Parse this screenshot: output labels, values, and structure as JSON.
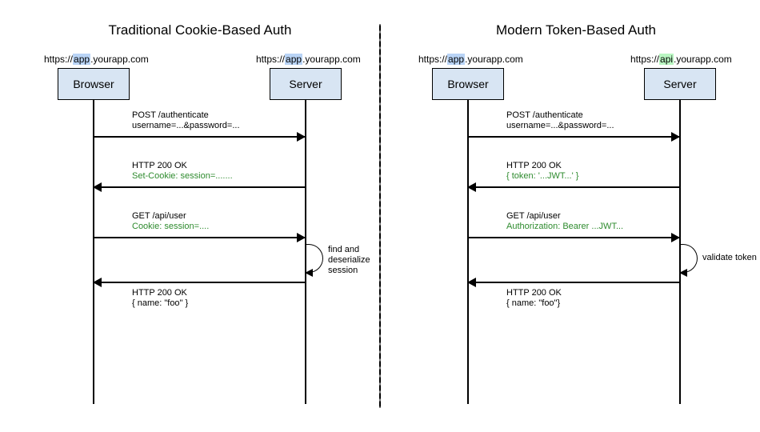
{
  "left": {
    "title": "Traditional Cookie-Based Auth",
    "browser_url_pre": "https://",
    "browser_url_hl": "app",
    "browser_url_post": ".yourapp.com",
    "server_url_pre": "https://",
    "server_url_hl": "app",
    "server_url_post": ".yourapp.com",
    "browser_label": "Browser",
    "server_label": "Server",
    "msg1_l1": "POST /authenticate",
    "msg1_l2": "username=...&password=...",
    "msg2_l1": "HTTP 200 OK",
    "msg2_l2": "Set-Cookie: session=.......",
    "msg3_l1": "GET /api/user",
    "msg3_l2": "Cookie: session=....",
    "self_note": "find and\ndeserialize\nsession",
    "msg4_l1": "HTTP 200 OK",
    "msg4_l2": "{  name: \"foo\" }"
  },
  "right": {
    "title": "Modern Token-Based Auth",
    "browser_url_pre": "https://",
    "browser_url_hl": "app",
    "browser_url_post": ".yourapp.com",
    "server_url_pre": "https://",
    "server_url_hl": "api",
    "server_url_post": ".yourapp.com",
    "browser_label": "Browser",
    "server_label": "Server",
    "msg1_l1": "POST /authenticate",
    "msg1_l2": "username=...&password=...",
    "msg2_l1": "HTTP 200 OK",
    "msg2_l2": "{ token: '...JWT...' }",
    "msg3_l1": "GET /api/user",
    "msg3_l2": "Authorization: Bearer ...JWT...",
    "self_note": "validate token",
    "msg4_l1": "HTTP 200 OK",
    "msg4_l2": "{ name: \"foo\"}"
  }
}
